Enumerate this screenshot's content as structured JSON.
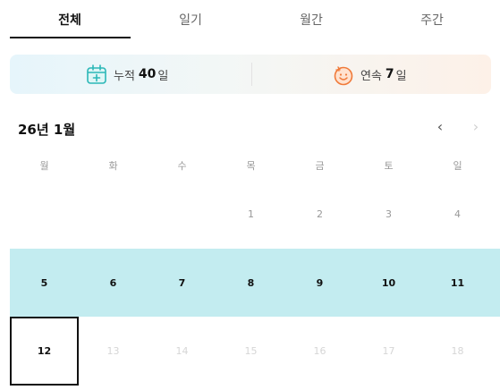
{
  "tabs": [
    {
      "label": "전체",
      "active": true
    },
    {
      "label": "일기",
      "active": false
    },
    {
      "label": "월간",
      "active": false
    },
    {
      "label": "주간",
      "active": false
    }
  ],
  "stats": {
    "cumulative": {
      "label": "누적",
      "value": "40",
      "unit": "일",
      "icon": "calendar-plus-icon"
    },
    "streak": {
      "label": "연속",
      "value": "7",
      "unit": "일",
      "icon": "smiling-face-icon"
    }
  },
  "calendar": {
    "title": "26년 1월",
    "prev_symbol": "‹",
    "next_symbol": "›",
    "weekdays": [
      "월",
      "화",
      "수",
      "목",
      "금",
      "토",
      "일"
    ],
    "week1": [
      "",
      "",
      "",
      "1",
      "2",
      "3",
      "4"
    ],
    "week2": [
      "5",
      "6",
      "7",
      "8",
      "9",
      "10",
      "11"
    ],
    "week3": [
      "12",
      "13",
      "14",
      "15",
      "16",
      "17",
      "18"
    ],
    "today": "12"
  },
  "colors": {
    "highlight_week": "#c3ecf0",
    "icon_teal": "#2bb7b7",
    "icon_orange": "#f07a3a"
  }
}
